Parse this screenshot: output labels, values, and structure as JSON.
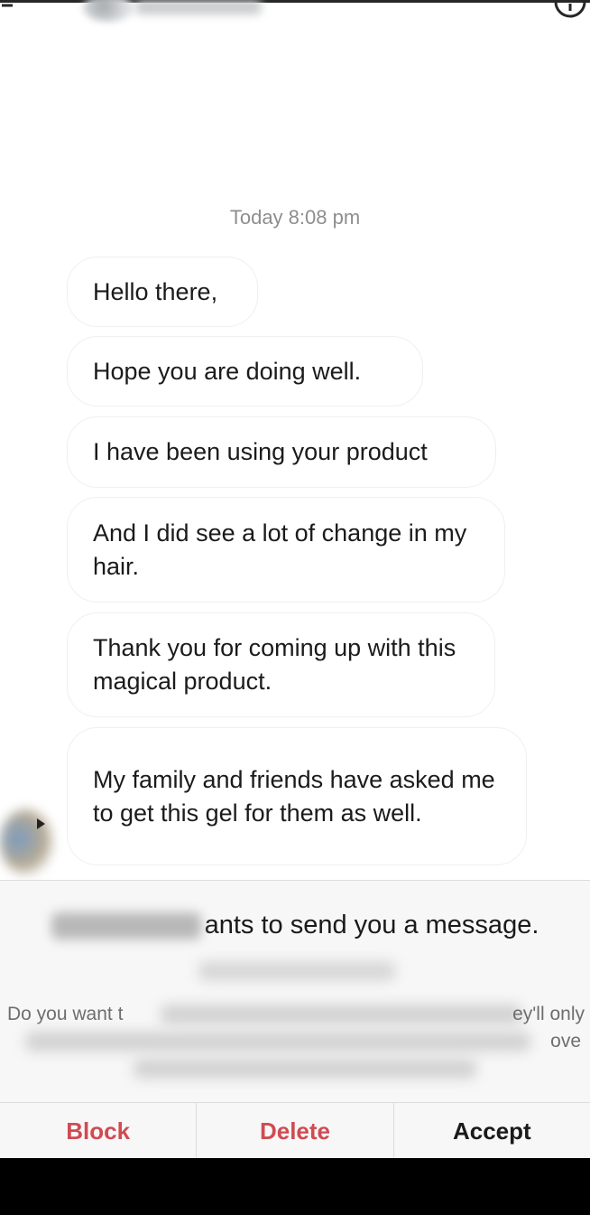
{
  "header": {
    "back_icon": "arrow-left-icon",
    "info_icon": "info-icon"
  },
  "timestamp": "Today 8:08 pm",
  "messages": [
    {
      "text": "Hello there,"
    },
    {
      "text": "Hope you are doing well."
    },
    {
      "text": "I have been using your product"
    },
    {
      "text": "And I did see a lot of change in my hair."
    },
    {
      "text": "Thank you for coming up with this magical product."
    },
    {
      "text": "My family and friends have asked me to get this gel for them as well."
    }
  ],
  "request": {
    "title_suffix": "ants to send you a message.",
    "description_fragments": {
      "line1_left": "Do you want t",
      "line1_right": "ey'll only",
      "line2_right": "ove"
    }
  },
  "actions": {
    "block": "Block",
    "delete": "Delete",
    "accept": "Accept"
  },
  "colors": {
    "destructive": "#d04b52",
    "timestamp": "#8e8e8e",
    "bubble_border": "#efefef"
  }
}
